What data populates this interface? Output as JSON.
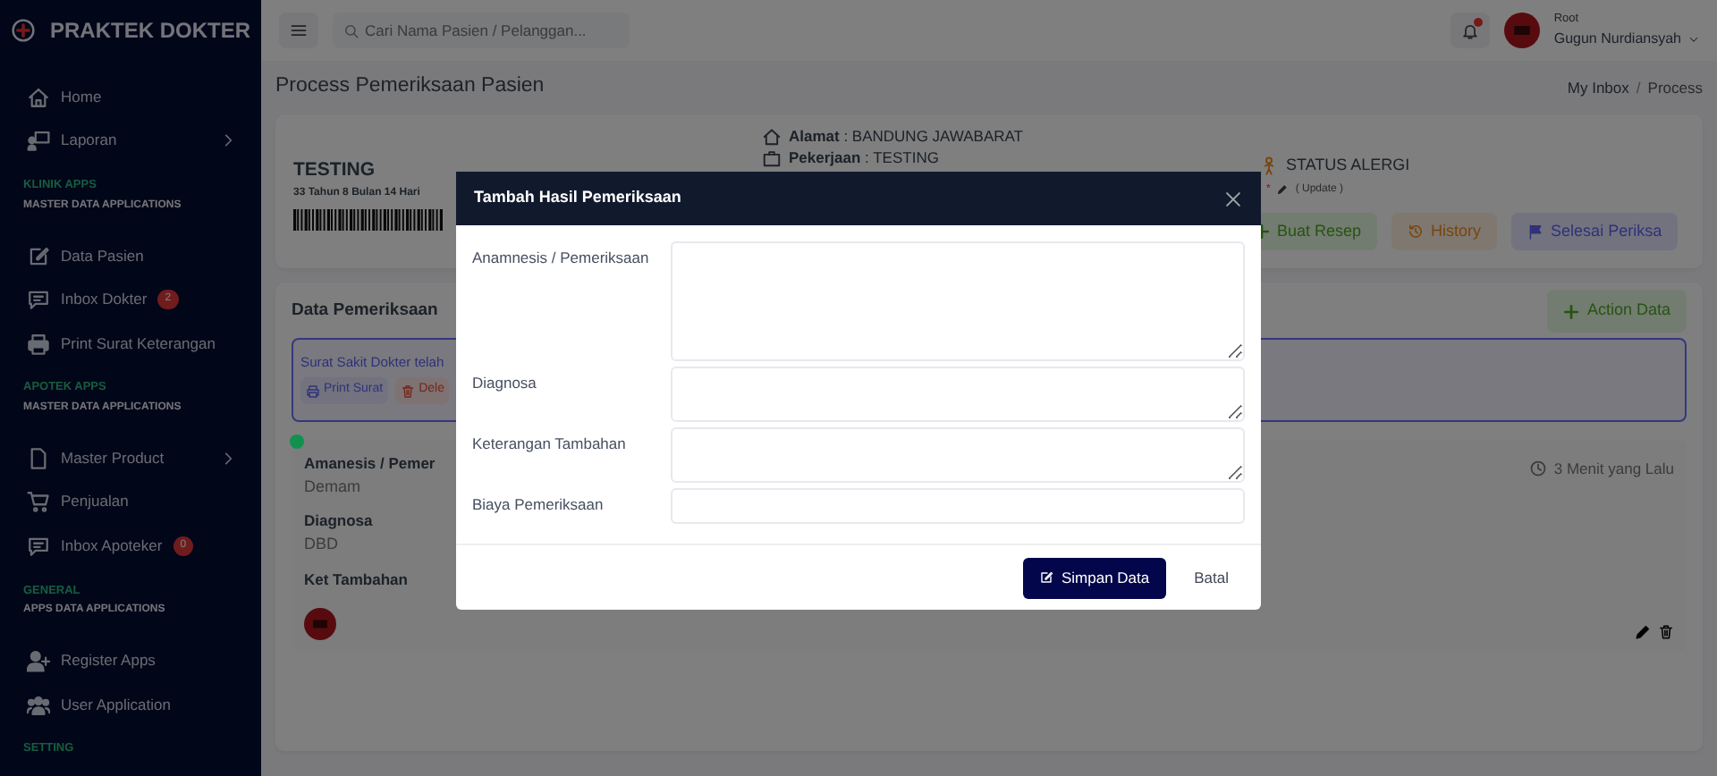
{
  "brand": "PRAKTEK DOKTER",
  "sidebar": {
    "items": [
      {
        "kind": "link",
        "label": "Home"
      },
      {
        "kind": "link",
        "label": "Laporan",
        "expanded": false
      },
      {
        "kind": "section",
        "title": "KLINIK APPS",
        "subtitle": "MASTER DATA APPLICATIONS"
      },
      {
        "kind": "link",
        "label": "Data Pasien"
      },
      {
        "kind": "link",
        "label": "Inbox Dokter",
        "badge": "2"
      },
      {
        "kind": "link",
        "label": "Print Surat Keterangan"
      },
      {
        "kind": "section",
        "title": "APOTEK APPS",
        "subtitle": "MASTER DATA APPLICATIONS"
      },
      {
        "kind": "link",
        "label": "Master Product",
        "expanded": false
      },
      {
        "kind": "link",
        "label": "Penjualan"
      },
      {
        "kind": "link",
        "label": "Inbox Apoteker",
        "badge": "0"
      },
      {
        "kind": "section",
        "title": "GENERAL",
        "subtitle": "APPS DATA APPLICATIONS"
      },
      {
        "kind": "link",
        "label": "Register Apps"
      },
      {
        "kind": "link",
        "label": "User Application"
      },
      {
        "kind": "section",
        "title": "SETTING"
      }
    ]
  },
  "topbar": {
    "search": {
      "placeholder": "Cari Nama Pasien / Pelanggan..."
    },
    "notification": {
      "unread": true
    },
    "user": {
      "role": "Root",
      "name": "Gugun Nurdiansyah"
    }
  },
  "page": {
    "title": "Process Pemeriksaan Pasien",
    "separator": "/",
    "breadcrumb": [
      {
        "label": "My Inbox",
        "selected": false
      },
      {
        "label": "Process",
        "selected": true
      }
    ]
  },
  "patient": {
    "name": "TESTING",
    "age": "33 Tahun 8 Bulan 14 Hari",
    "details": [
      "**Alamat** : BANDUNG JAWABARAT",
      "**Pekerjaan** : TESTING"
    ],
    "allergy": {
      "title": "STATUS ALERGI",
      "mark": "*",
      "update": "( Update )"
    },
    "actions": [
      {
        "label": "Buat Resep",
        "kind": "success"
      },
      {
        "label": "History",
        "kind": "warning"
      },
      {
        "label": "Selesai Periksa",
        "kind": "primary"
      }
    ]
  },
  "records": {
    "title": "Data Pemeriksaan",
    "action": "Action Data",
    "alert": {
      "text": "Surat Sakit Dokter telah",
      "buttons": [
        {
          "label": "Print Surat",
          "kind": "primary"
        },
        {
          "label": "Dele",
          "kind": "danger"
        }
      ]
    },
    "entries": [
      {
        "color": "#10914f",
        "time": "3 Menit yang Lalu",
        "fields": [
          {
            "label": "Amanesis / Pemer",
            "value": "Demam"
          },
          {
            "label": "Diagnosa",
            "value": "DBD"
          },
          {
            "label": "Ket Tambahan"
          }
        ]
      }
    ]
  },
  "modal": {
    "title": "Tambah Hasil Pemeriksaan",
    "fields": [
      {
        "label": "Anamnesis / Pemeriksaan",
        "kind": "textarea"
      },
      {
        "label": "Diagnosa",
        "kind": "textarea"
      },
      {
        "label": "Keterangan Tambahan",
        "kind": "textarea"
      },
      {
        "label": "Biaya Pemeriksaan",
        "kind": "input"
      }
    ],
    "buttons": [
      {
        "label": "Simpan Data",
        "kind": "primary"
      },
      {
        "label": "Batal",
        "kind": "link"
      }
    ]
  }
}
